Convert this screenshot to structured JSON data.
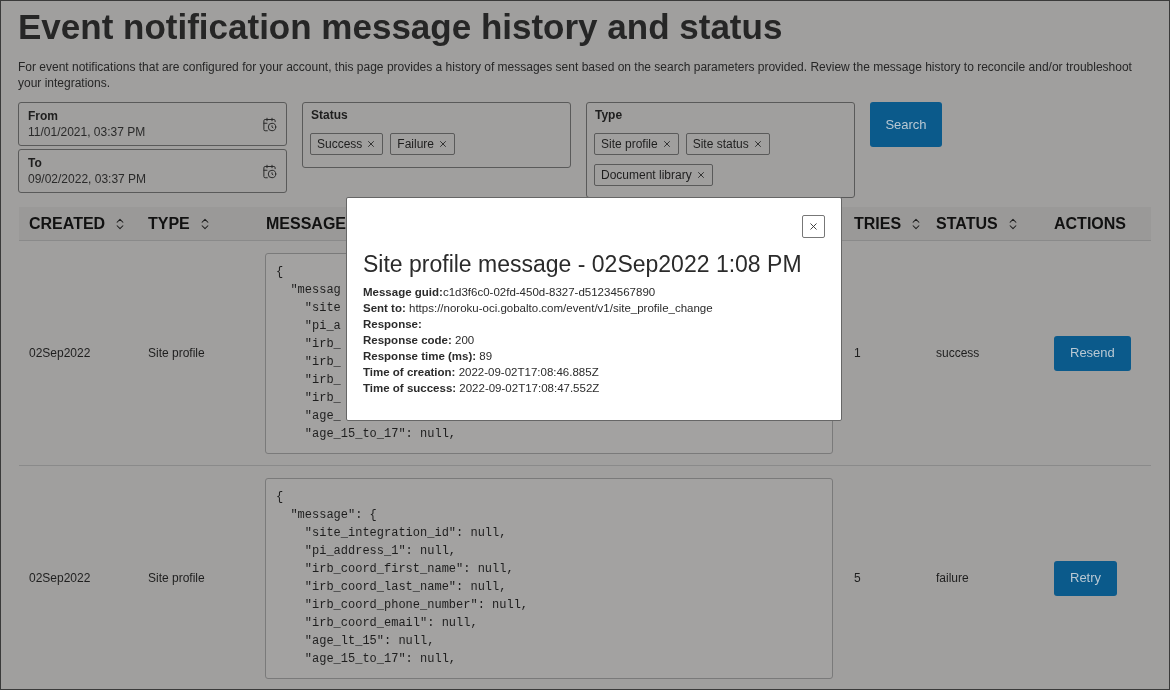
{
  "page": {
    "title": "Event notification message history and status",
    "description": "For event notifications that are configured for your account, this page provides a history of messages sent based on the search parameters provided. Review the message history to reconcile and/or troubleshoot your integrations."
  },
  "filters": {
    "from": {
      "label": "From",
      "value": "11/01/2021, 03:37 PM"
    },
    "to": {
      "label": "To",
      "value": "09/02/2022, 03:37 PM"
    },
    "status": {
      "label": "Status",
      "chips": [
        "Success",
        "Failure"
      ]
    },
    "type": {
      "label": "Type",
      "chips": [
        "Site profile",
        "Site status",
        "Document library"
      ]
    },
    "search_button": "Search"
  },
  "table": {
    "columns": [
      {
        "label": "CREATED",
        "sortable": true
      },
      {
        "label": "TYPE",
        "sortable": true
      },
      {
        "label": "MESSAGE",
        "sortable": false
      },
      {
        "label": "TRIES",
        "sortable": true
      },
      {
        "label": "STATUS",
        "sortable": true
      },
      {
        "label": "ACTIONS",
        "sortable": false
      }
    ],
    "rows": [
      {
        "created": "02Sep2022",
        "type": "Site profile",
        "message_lines": [
          "{",
          "  \"messag",
          "    \"site",
          "    \"pi_a",
          "    \"irb_",
          "    \"irb_",
          "    \"irb_",
          "    \"irb_",
          "    \"age_",
          "    \"age_15_to_17\": null,"
        ],
        "tries": "1",
        "status": "success",
        "action": "Resend"
      },
      {
        "created": "02Sep2022",
        "type": "Site profile",
        "message_lines": [
          "{",
          "  \"message\": {",
          "    \"site_integration_id\": null,",
          "    \"pi_address_1\": null,",
          "    \"irb_coord_first_name\": null,",
          "    \"irb_coord_last_name\": null,",
          "    \"irb_coord_phone_number\": null,",
          "    \"irb_coord_email\": null,",
          "    \"age_lt_15\": null,",
          "    \"age_15_to_17\": null,"
        ],
        "tries": "5",
        "status": "failure",
        "action": "Retry"
      }
    ]
  },
  "dialog": {
    "title": "Site profile message - 02Sep2022 1:08 PM",
    "lines": [
      "**Message guid:**c1d3f6c0-02fd-450d-8327-d51234567890",
      "**Sent to:** https://noroku-oci.gobalto.com/event/v1/site_profile_change",
      "**Response:**",
      "**Response code:** 200",
      "**Response time (ms):** 89",
      "**Time of creation:** 2022-09-02T17:08:46.885Z",
      "**Time of success:** 2022-09-02T17:08:47.552Z"
    ]
  }
}
